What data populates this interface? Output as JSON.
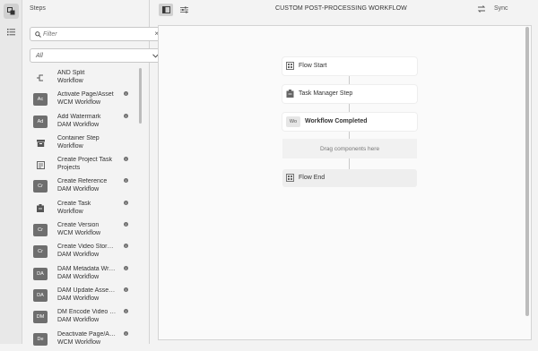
{
  "rail": {
    "icons": [
      "workflow-icon",
      "list-icon"
    ]
  },
  "panel": {
    "title": "Steps",
    "filter_placeholder": "Filter",
    "select_value": "All",
    "steps": [
      {
        "name": "AND Split",
        "sub": "Workflow",
        "icon": "and-split-icon",
        "badge": "",
        "info": false
      },
      {
        "name": "Activate Page/Asset",
        "sub": "WCM Workflow",
        "icon": "",
        "badge": "Ac",
        "info": true
      },
      {
        "name": "Add Watermark",
        "sub": "DAM Workflow",
        "icon": "",
        "badge": "Ad",
        "info": true
      },
      {
        "name": "Container Step",
        "sub": "Workflow",
        "icon": "container-icon",
        "badge": "",
        "info": false
      },
      {
        "name": "Create Project Task",
        "sub": "Projects",
        "icon": "project-task-icon",
        "badge": "",
        "info": true
      },
      {
        "name": "Create Reference",
        "sub": "DAM Workflow",
        "icon": "",
        "badge": "Cr",
        "info": true
      },
      {
        "name": "Create Task",
        "sub": "Workflow",
        "icon": "task-icon",
        "badge": "",
        "info": true
      },
      {
        "name": "Create Version",
        "sub": "WCM Workflow",
        "icon": "",
        "badge": "Cr",
        "info": true
      },
      {
        "name": "Create Video Stor…",
        "sub": "DAM Workflow",
        "icon": "",
        "badge": "Cr",
        "info": true
      },
      {
        "name": "DAM Metadata Wr…",
        "sub": "DAM Workflow",
        "icon": "",
        "badge": "DA",
        "info": true
      },
      {
        "name": "DAM Update Asse…",
        "sub": "DAM Workflow",
        "icon": "",
        "badge": "DA",
        "info": true
      },
      {
        "name": "DM Encode Video …",
        "sub": "DAM Workflow",
        "icon": "",
        "badge": "DM",
        "info": true
      },
      {
        "name": "Deactivate Page/A…",
        "sub": "WCM Workflow",
        "icon": "",
        "badge": "De",
        "info": true
      }
    ]
  },
  "topbar": {
    "title": "CUSTOM POST-PROCESSING WORKFLOW",
    "sync_label": "Sync"
  },
  "canvas": {
    "nodes": [
      {
        "label": "Flow Start",
        "icon": "flow-start-icon",
        "badge": ""
      },
      {
        "label": "Task Manager Step",
        "icon": "task-icon",
        "badge": ""
      },
      {
        "label": "Workflow Completed",
        "icon": "",
        "badge": "Wo"
      }
    ],
    "dropzone_text": "Drag components here",
    "end_node": {
      "label": "Flow End",
      "icon": "flow-end-icon"
    }
  }
}
